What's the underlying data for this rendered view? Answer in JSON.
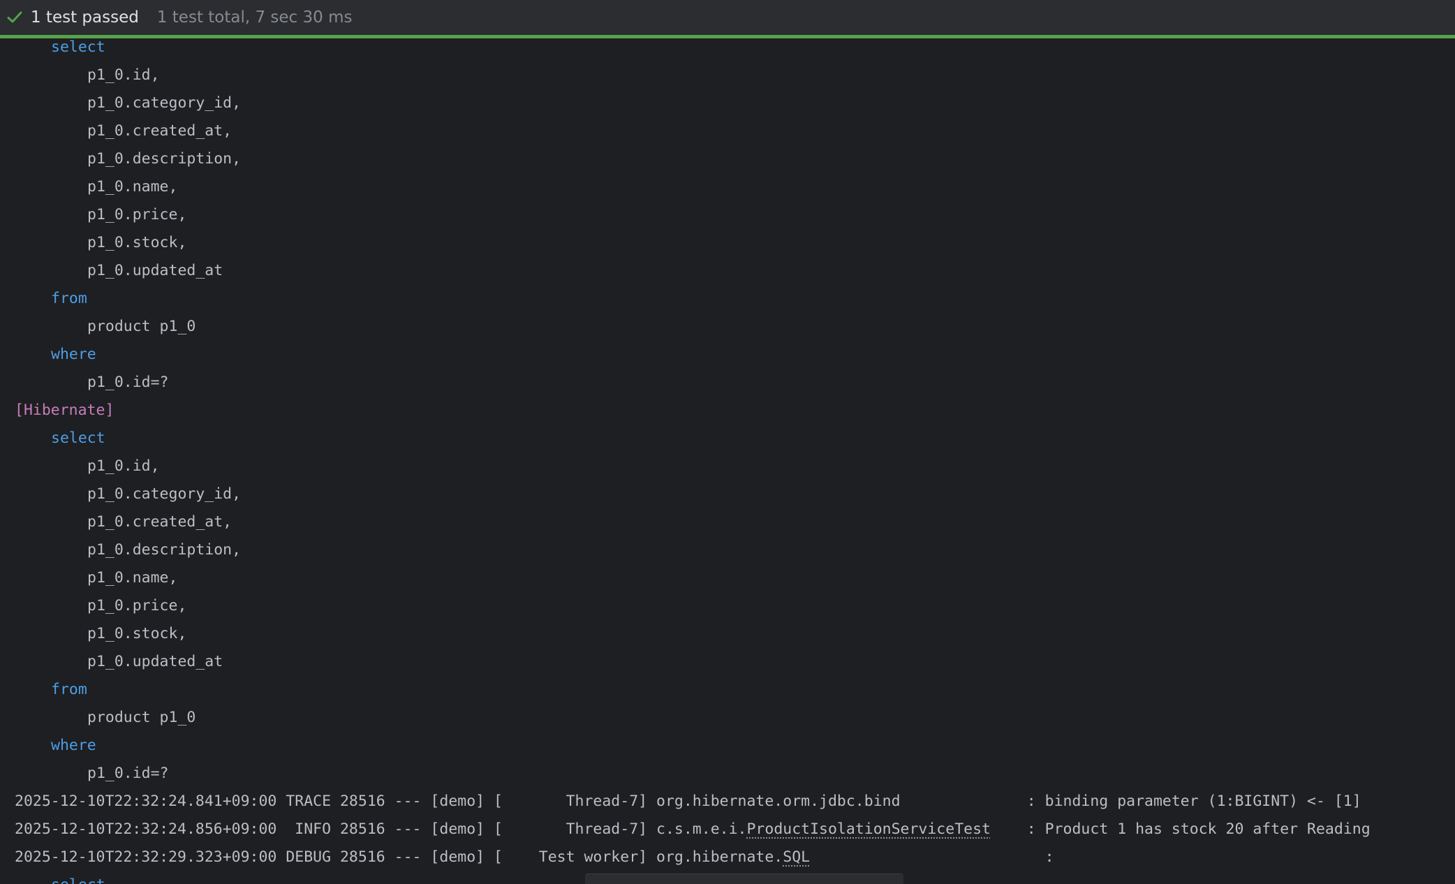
{
  "status": {
    "label": "1 test passed",
    "detail": "1 test total, 7 sec 30 ms",
    "icon": "check-icon",
    "color": "#55a34a"
  },
  "console": {
    "sql_block_1": {
      "select": "select",
      "cols": [
        "p1_0.id,",
        "p1_0.category_id,",
        "p1_0.created_at,",
        "p1_0.description,",
        "p1_0.name,",
        "p1_0.price,",
        "p1_0.stock,",
        "p1_0.updated_at"
      ],
      "from": "from",
      "table": "product p1_0",
      "where": "where",
      "cond": "p1_0.id=?"
    },
    "hibernate_tag": "[Hibernate]",
    "sql_block_2": {
      "select": "select",
      "cols": [
        "p1_0.id,",
        "p1_0.category_id,",
        "p1_0.created_at,",
        "p1_0.description,",
        "p1_0.name,",
        "p1_0.price,",
        "p1_0.stock,",
        "p1_0.updated_at"
      ],
      "from": "from",
      "table": "product p1_0",
      "where": "where",
      "cond": "p1_0.id=?"
    },
    "logs": [
      {
        "prefix": "2025-12-10T22:32:24.841+09:00 TRACE 28516 --- [demo] [       Thread-7] ",
        "logger_pre": "org.hibernate.orm.jdbc.bind",
        "logger_link": "",
        "logger_post": "",
        "pad": "              ",
        "message": ": binding parameter (1:BIGINT) <- [1]"
      },
      {
        "prefix": "2025-12-10T22:32:24.856+09:00  INFO 28516 --- [demo] [       Thread-7] ",
        "logger_pre": "c.s.m.e.i.",
        "logger_link": "ProductIsolationServiceTest",
        "logger_post": "",
        "pad": "    ",
        "message": ": Product 1 has stock 20 after Reading"
      },
      {
        "prefix": "2025-12-10T22:32:29.323+09:00 DEBUG 28516 --- [demo] [    Test worker] ",
        "logger_pre": "org.hibernate.",
        "logger_link": "SQL",
        "logger_post": "",
        "pad": "                          ",
        "message": ":"
      }
    ],
    "trailing": "select"
  }
}
